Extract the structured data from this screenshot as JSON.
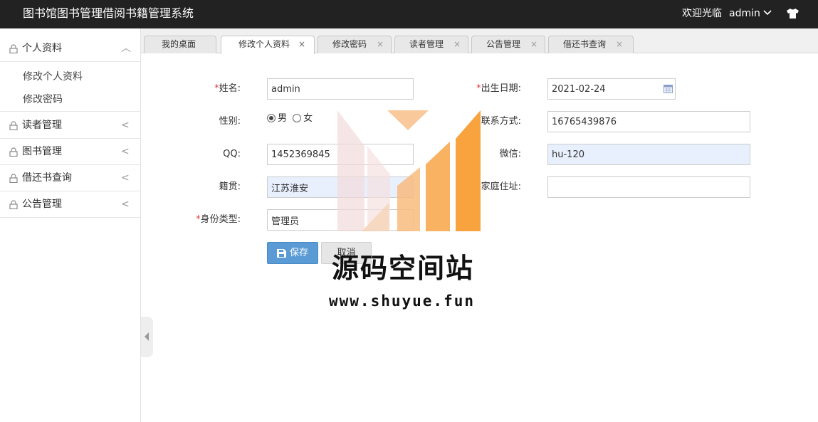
{
  "header": {
    "title": "图书馆图书管理借阅书籍管理系统",
    "welcome": "欢迎光临",
    "username": "admin"
  },
  "sidebar": {
    "groups": [
      {
        "label": "个人资料",
        "icon": "lock-icon",
        "expanded": true,
        "arrow": "︿",
        "children": [
          "修改个人资料",
          "修改密码"
        ]
      },
      {
        "label": "读者管理",
        "icon": "lock-icon",
        "arrow": "<"
      },
      {
        "label": "图书管理",
        "icon": "lock-icon",
        "arrow": "<"
      },
      {
        "label": "借还书查询",
        "icon": "lock-icon",
        "arrow": "<"
      },
      {
        "label": "公告管理",
        "icon": "lock-icon",
        "arrow": "<"
      }
    ]
  },
  "tabs": [
    {
      "label": "我的桌面",
      "closable": false
    },
    {
      "label": "修改个人资料",
      "closable": true,
      "active": true
    },
    {
      "label": "修改密码",
      "closable": true
    },
    {
      "label": "读者管理",
      "closable": true
    },
    {
      "label": "公告管理",
      "closable": true
    },
    {
      "label": "借还书查询",
      "closable": true
    }
  ],
  "close_glyph": "×",
  "form": {
    "required_mark": "*",
    "name_label": "姓名:",
    "name_value": "admin",
    "birth_label": "出生日期:",
    "birth_value": "2021-02-24",
    "gender_label": "性别:",
    "gender_male": "男",
    "gender_female": "女",
    "gender_selected": "男",
    "contact_label": "联系方式:",
    "contact_value": "16765439876",
    "qq_label": "QQ:",
    "qq_value": "1452369845",
    "wechat_label": "微信:",
    "wechat_value": "hu-120",
    "native_label": "籍贯:",
    "native_value": "江苏淮安",
    "address_label": "家庭住址:",
    "address_value": "",
    "role_label": "身份类型:",
    "role_value": "管理员",
    "save_label": "保存",
    "cancel_label": "取消"
  },
  "watermark": {
    "title": "源码空间站",
    "url": "www.shuyue.fun"
  },
  "colors": {
    "header_bg": "#222222",
    "save_button": "#5b9bd5",
    "required": "#e4393c",
    "autofill_bg": "#e8f0fe",
    "watermark_orange": "#f7941d"
  }
}
